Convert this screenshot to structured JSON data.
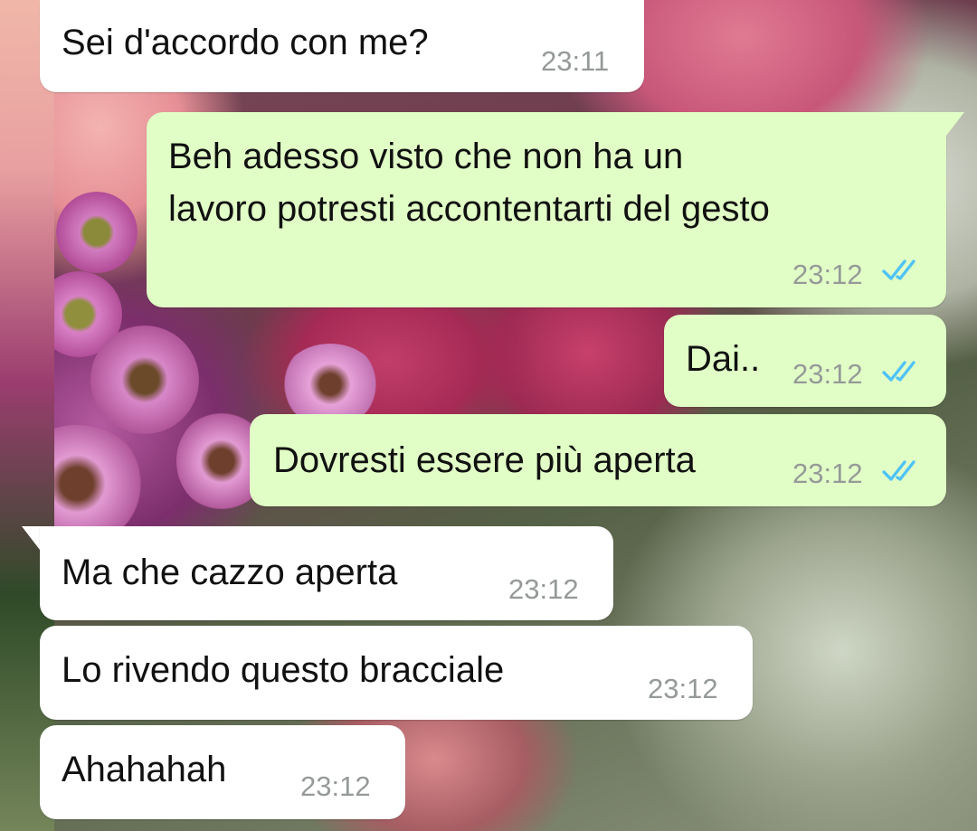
{
  "conversation": {
    "messages": [
      {
        "direction": "incoming",
        "text": "Sei d'accordo con me?",
        "time": "23:11"
      },
      {
        "direction": "outgoing",
        "text_lines": [
          "Beh adesso visto che non ha un",
          "lavoro potresti accontentarti del gesto"
        ],
        "time": "23:12",
        "status": "read"
      },
      {
        "direction": "outgoing",
        "text": "Dai..",
        "time": "23:12",
        "status": "read"
      },
      {
        "direction": "outgoing",
        "text": "Dovresti essere più aperta",
        "time": "23:12",
        "status": "read"
      },
      {
        "direction": "incoming",
        "text": "Ma che cazzo aperta",
        "time": "23:12"
      },
      {
        "direction": "incoming",
        "text": "Lo rivendo questo bracciale",
        "time": "23:12"
      },
      {
        "direction": "incoming",
        "text": "Ahahahah",
        "time": "23:12"
      }
    ]
  },
  "colors": {
    "incoming_bubble": "#ffffff",
    "outgoing_bubble": "#e1fec6",
    "read_tick": "#4fc3f7",
    "timestamp": "#959a98"
  },
  "icons": {
    "read_receipt": "double-check-icon"
  }
}
